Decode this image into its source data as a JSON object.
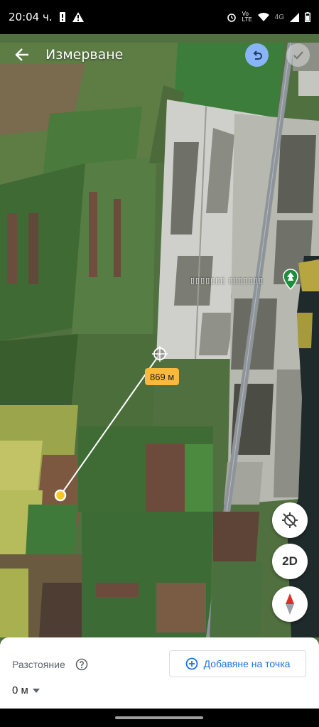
{
  "status_bar": {
    "time": "20:04 ч.",
    "network": "4G",
    "volte": "Vo LTE"
  },
  "header": {
    "title": "Измерване"
  },
  "map": {
    "distance_label": "869 м",
    "place_label": "▯▯▯▯▯▯▯ ▯▯▯▯▯▯▯",
    "fab_2d_label": "2D"
  },
  "bottom_sheet": {
    "distance_title": "Разстояние",
    "distance_value": "0 м",
    "add_point_label": "Добавяне на точка"
  },
  "colors": {
    "accent": "#1a73e8",
    "undo_bg": "#8ab4f8",
    "badge": "#f9b93c",
    "marker": "#f9c623"
  }
}
